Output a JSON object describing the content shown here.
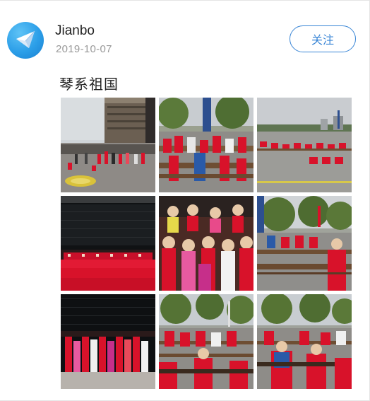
{
  "post": {
    "author": {
      "name": "Jianbo",
      "avatar_icon": "paper-plane-icon"
    },
    "date": "2019-10-07",
    "follow_label": "关注",
    "title": "琴系祖国",
    "photos": [
      {
        "index": 1,
        "scene": "plaza-building-performers"
      },
      {
        "index": 2,
        "scene": "outdoor-guzheng-players-trees"
      },
      {
        "index": 3,
        "scene": "plaza-red-rows-skyline"
      },
      {
        "index": 4,
        "scene": "stage-choir-red-dark-backdrop"
      },
      {
        "index": 5,
        "scene": "group-children-red-costumes"
      },
      {
        "index": 6,
        "scene": "plaza-guzheng-row-trees"
      },
      {
        "index": 7,
        "scene": "stage-children-dark-backdrop"
      },
      {
        "index": 8,
        "scene": "performers-red-zither-rows"
      },
      {
        "index": 9,
        "scene": "performers-blue-vest-zither"
      }
    ]
  },
  "colors": {
    "accent": "#3a86d6",
    "username": "#222222",
    "date": "#999999",
    "costume_red": "#d8122a"
  }
}
